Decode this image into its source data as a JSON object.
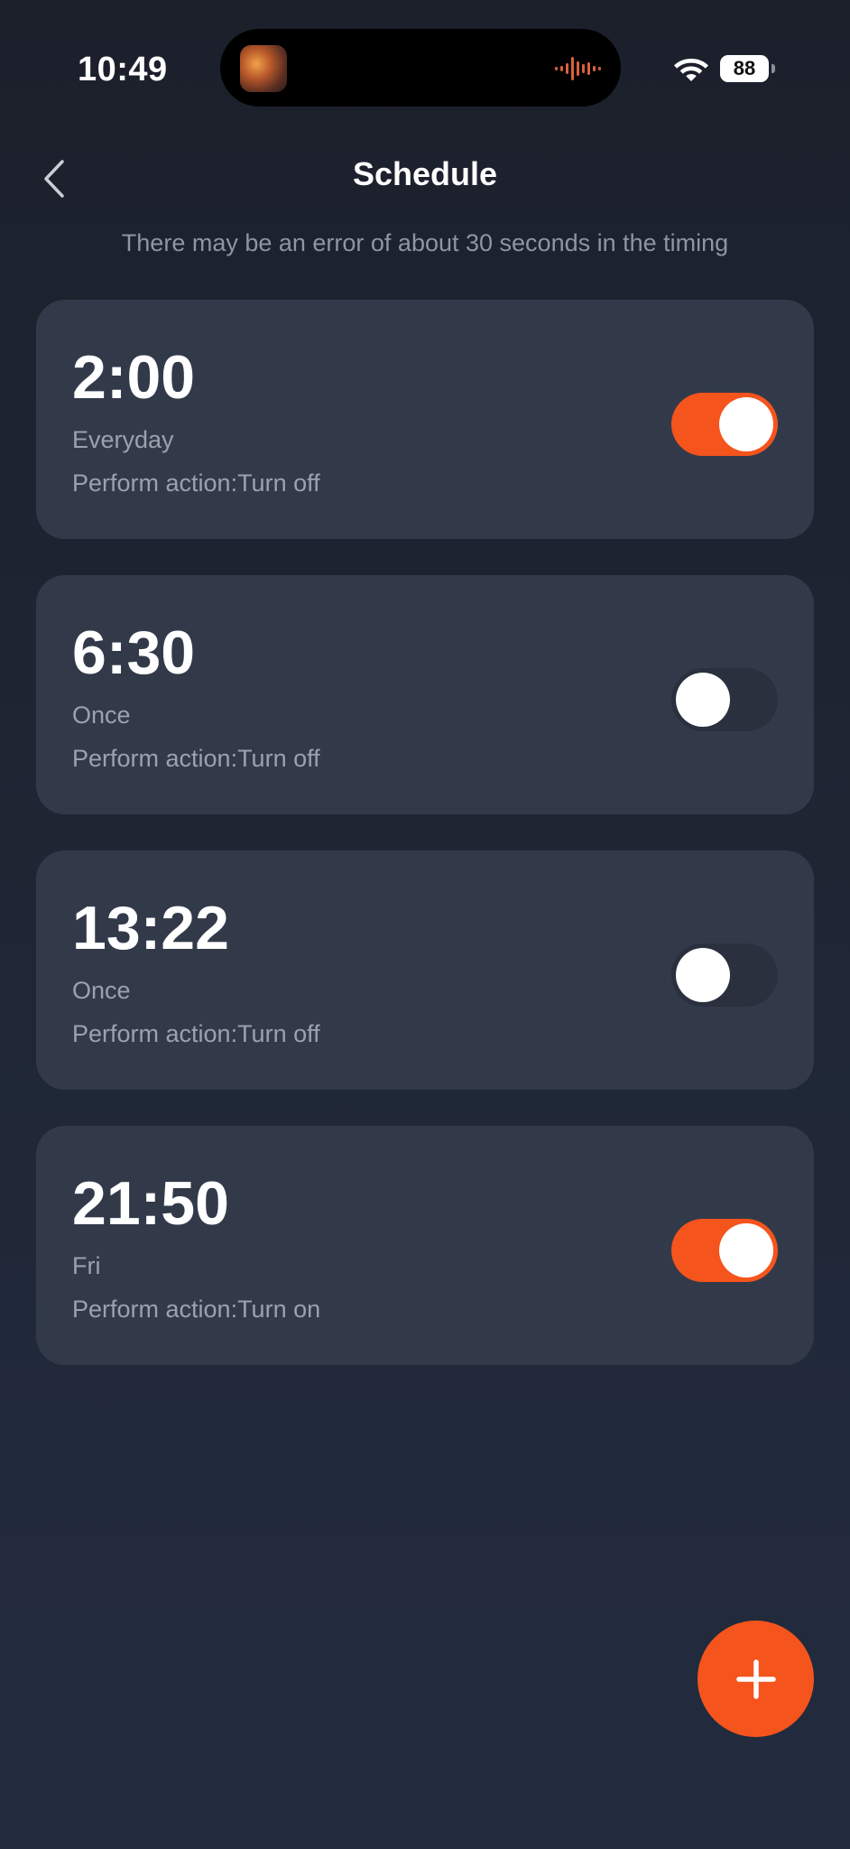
{
  "status_bar": {
    "time": "10:49",
    "battery": "88"
  },
  "header": {
    "title": "Schedule",
    "subtitle": "There may be an error of about 30 seconds in the timing"
  },
  "schedules": [
    {
      "time": "2:00",
      "repeat": "Everyday",
      "action": "Perform action:Turn off",
      "enabled": true
    },
    {
      "time": "6:30",
      "repeat": "Once",
      "action": "Perform action:Turn off",
      "enabled": false
    },
    {
      "time": "13:22",
      "repeat": "Once",
      "action": "Perform action:Turn off",
      "enabled": false
    },
    {
      "time": "21:50",
      "repeat": "Fri",
      "action": "Perform action:Turn on",
      "enabled": true
    }
  ],
  "colors": {
    "accent": "#f5541d",
    "card": "#323a4a",
    "toggle_off": "#2a303d"
  },
  "icons": {
    "back": "chevron-left-icon",
    "add": "plus-icon",
    "wifi": "wifi-icon",
    "audio": "audio-waveform-icon"
  }
}
